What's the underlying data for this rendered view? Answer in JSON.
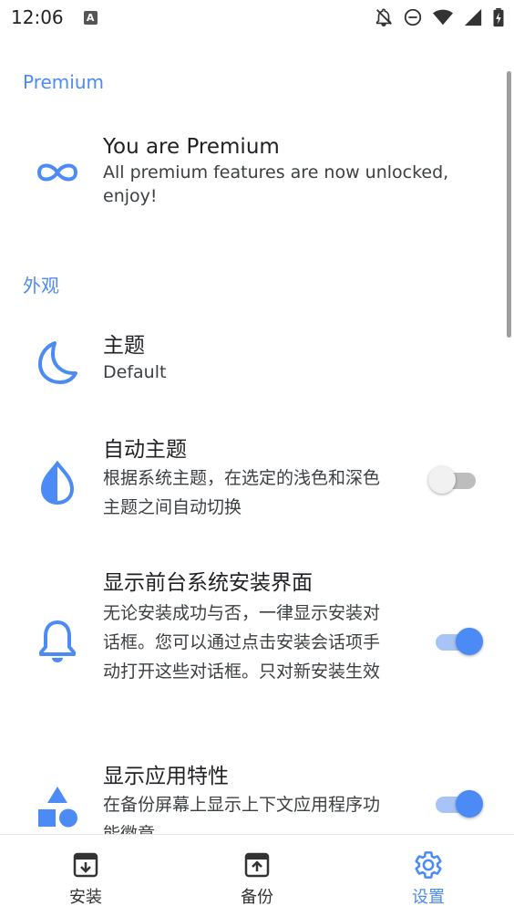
{
  "status_bar": {
    "time": "12:06",
    "notification_badge": "A"
  },
  "sections": {
    "premium": {
      "header": "Premium",
      "title": "You are Premium",
      "summary": "All premium features are now unlocked, enjoy!"
    },
    "appearance": {
      "header": "外观"
    }
  },
  "settings": {
    "theme": {
      "title": "主题",
      "summary": "Default"
    },
    "auto_theme": {
      "title": "自动主题",
      "summary": "根据系统主题，在选定的浅色和深色主题之间自动切换",
      "enabled": false
    },
    "show_install_ui": {
      "title": "显示前台系统安装界面",
      "summary": "无论安装成功与否，一律显示安装对话框。您可以通过点击安装会话项手动打开这些对话框。只对新安装生效",
      "enabled": true
    },
    "show_app_features": {
      "title": "显示应用特性",
      "summary": "在备份屏幕上显示上下文应用程序功能徽章",
      "enabled": true
    }
  },
  "bottom_nav": {
    "install": "安装",
    "backup": "备份",
    "settings": "设置",
    "active": "settings"
  },
  "colors": {
    "accent": "#4c8bf5",
    "text": "#202124"
  }
}
